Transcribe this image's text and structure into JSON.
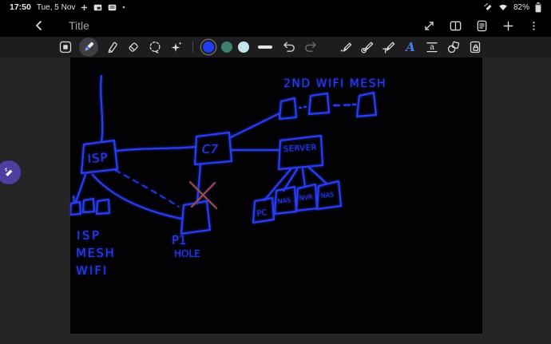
{
  "status_bar": {
    "time": "17:50",
    "date": "Tue, 5 Nov",
    "battery_percent": "82%",
    "icons": [
      "pin-icon",
      "picture-notification-icon",
      "app-notification-icon",
      "more-notifications-dot",
      "s-pen-connected-icon",
      "wifi-icon",
      "battery-icon"
    ]
  },
  "title_bar": {
    "title": "Title",
    "icons": [
      "back-icon",
      "fullscreen-icon",
      "page-view-icon",
      "note-list-icon",
      "add-page-icon",
      "more-menu-icon"
    ]
  },
  "toolbar": {
    "icons": [
      "frame-icon",
      "pen-icon",
      "highlighter-icon",
      "eraser-icon",
      "lasso-icon",
      "sparkle-pens-icon",
      "stroke-width-icon",
      "undo-icon",
      "redo-icon",
      "pen-star-icon",
      "pen-clock-icon",
      "pen-text-icon",
      "letter-a-icon",
      "text-format-icon",
      "shapes-icon",
      "page-lock-icon"
    ],
    "letter_a": "A",
    "letter_a_small": "a",
    "colors": {
      "selected_blue": "#1e3ef0",
      "teal": "#3e8070",
      "pale_blue": "#c3e4ec"
    }
  },
  "canvas": {
    "ink_color": "#2a3cf2",
    "cross_color": "#a7502c",
    "labels": {
      "mesh_title": "2ND WIFI MESH",
      "isp": "ISP",
      "c7": "C7",
      "server": "SERVER",
      "pc": "PC",
      "nas1": "NAS",
      "nvr": "NVR",
      "nas2": "NAS",
      "pihole_line1": "P1",
      "pihole_line2": "HOLE",
      "isp_mesh_line1": "ISP",
      "isp_mesh_line2": "MESH",
      "isp_mesh_line3": "WIFI"
    }
  },
  "fab": {
    "color": "#4c3fa0"
  }
}
